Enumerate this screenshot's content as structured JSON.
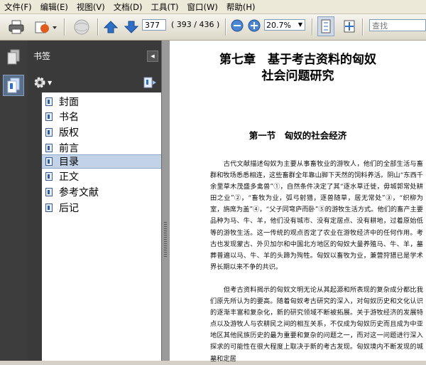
{
  "menu": [
    "文件(F)",
    "编辑(E)",
    "视图(V)",
    "文档(D)",
    "工具(T)",
    "窗口(W)",
    "帮助(H)"
  ],
  "toolbar": {
    "page_current": "377",
    "page_count": "( 393 / 436 )",
    "zoom": "20.7%",
    "search_placeholder": "查找"
  },
  "panel": {
    "title": "书签",
    "bookmarks": [
      {
        "label": "封面",
        "selected": false
      },
      {
        "label": "书名",
        "selected": false
      },
      {
        "label": "版权",
        "selected": false
      },
      {
        "label": "前言",
        "selected": false
      },
      {
        "label": "目录",
        "selected": true
      },
      {
        "label": "正文",
        "selected": false
      },
      {
        "label": "参考文献",
        "selected": false
      },
      {
        "label": "后记",
        "selected": false
      }
    ]
  },
  "document": {
    "chapter_line1": "第七章　基于考古资料的匈奴",
    "chapter_line2": "社会问题研究",
    "section_title": "第一节　匈奴的社会经济",
    "paragraph1": "　　古代文献描述匈奴为主要从事畜牧业的游牧人，他们的全部生活与畜群和牧场悉悉相连，这些畜群全年靠山脚下天然的饲料养活。阴山“东西千余里草木茂盛多禽兽”①，自然条件决定了其“逐水草迁徙，毋城郭常处耕田之业”②，“畜牧为业，弧弓射猎，逐兽随草，居无常处”③，“织柳为室，旃席为盖”④，“父子同穹庐而卧”⑤的游牧生活方式。他们的畜产主要品种为马、牛、羊，他们没有城市、没有定居点、没有耕地，过着原始低等的游牧生活。这一传统的观点否定了农业在游牧经济中的任何作用。考古也发现蒙古、外贝加尔和中国北方地区的匈奴大量养殖马、牛、羊，墓葬普遍以马、牛、羊的头蹄为殉牲。匈奴以畜牧为业，兼营狩猎已是学术界长期以来不争的共识。",
    "paragraph2": "　　但考古资料揭示的匈奴文明无论从其起源和所表现的复杂成分都比我们原先所认为的要高。随着匈奴考古研究的深入，对匈奴历史和文化认识的逐渐丰富和复杂化，新的研究领域不断被拓展。关于游牧经济的发展特点以及游牧人与农耕民之间的相互关系，不仅成为匈奴历史而且成为中亚地区其他民族历史的最为重要和复杂的问题之一，而对这一问题进行深入探求的可能性在很大程度上取决于新的考古发现。匈奴境内不断发现的城墓和定居"
  },
  "colors": {
    "accent_blue": "#2f6fc6",
    "panel_dark": "#3a3a3a",
    "selection": "#c3d3e7"
  }
}
